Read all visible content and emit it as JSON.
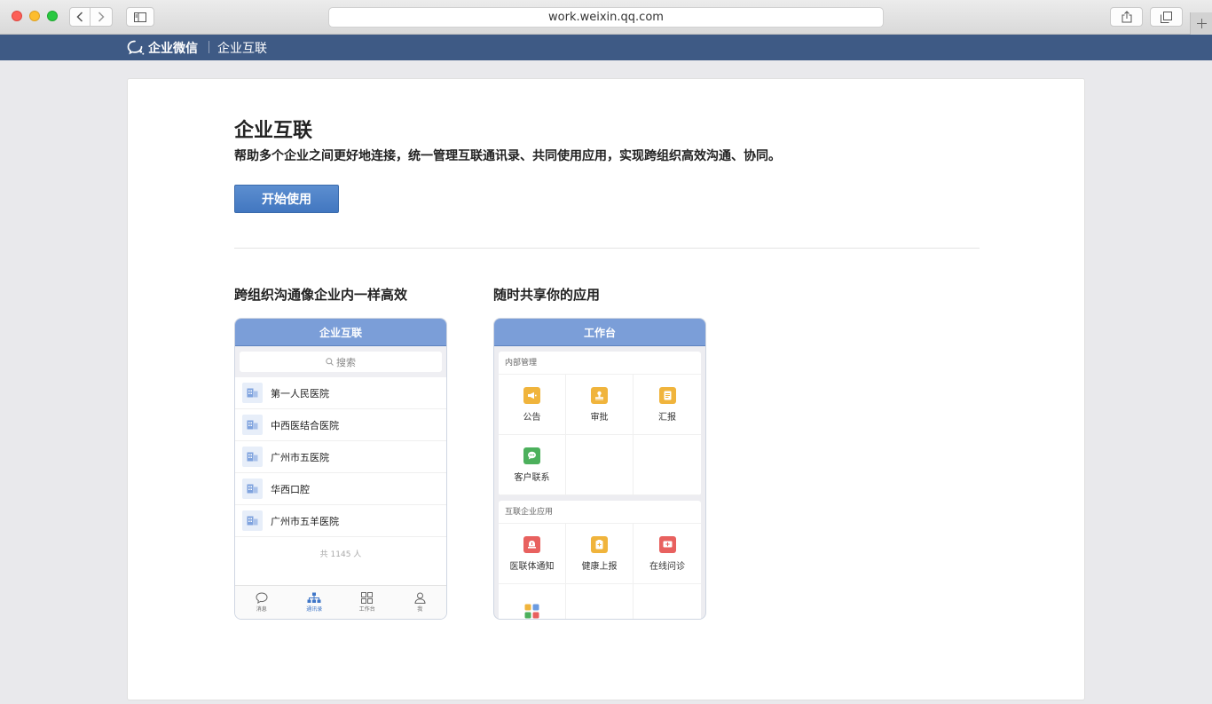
{
  "browser": {
    "url": "work.weixin.qq.com"
  },
  "site_header": {
    "logo_text": "企业微信",
    "section": "企业互联"
  },
  "main": {
    "title": "企业互联",
    "description": "帮助多个企业之间更好地连接，统一管理互联通讯录、共同使用应用，实现跨组织高效沟通、协同。",
    "start_button": "开始使用"
  },
  "feature_left": {
    "title": "跨组织沟通像企业内一样高效",
    "phone": {
      "header": "企业互联",
      "search_placeholder": "搜索",
      "orgs": [
        {
          "name": "第一人民医院"
        },
        {
          "name": "中西医结合医院"
        },
        {
          "name": "广州市五医院"
        },
        {
          "name": "华西口腔"
        },
        {
          "name": "广州市五羊医院"
        }
      ],
      "total": "共 1145 人",
      "tabs": [
        {
          "label": "消息",
          "icon": "chat-bubble-icon"
        },
        {
          "label": "通讯录",
          "icon": "org-chart-icon",
          "active": true
        },
        {
          "label": "工作台",
          "icon": "grid-icon"
        },
        {
          "label": "我",
          "icon": "person-icon"
        }
      ]
    }
  },
  "feature_right": {
    "title": "随时共享你的应用",
    "phone": {
      "header": "工作台",
      "groups": [
        {
          "label": "内部管理",
          "apps": [
            {
              "name": "公告",
              "icon": "megaphone-icon",
              "color": "#f0b43c"
            },
            {
              "name": "审批",
              "icon": "stamp-icon",
              "color": "#f0b43c"
            },
            {
              "name": "汇报",
              "icon": "report-icon",
              "color": "#f0b43c"
            },
            {
              "name": "客户联系",
              "icon": "chat-icon",
              "color": "#4cb05c"
            }
          ]
        },
        {
          "label": "互联企业应用",
          "apps": [
            {
              "name": "医联体通知",
              "icon": "alert-icon",
              "color": "#e8615f"
            },
            {
              "name": "健康上报",
              "icon": "health-icon",
              "color": "#f0b43c"
            },
            {
              "name": "在线问诊",
              "icon": "consult-icon",
              "color": "#e8615f"
            },
            {
              "name": "",
              "icon": "app-grid-icon",
              "color": "multi"
            }
          ]
        }
      ]
    }
  }
}
